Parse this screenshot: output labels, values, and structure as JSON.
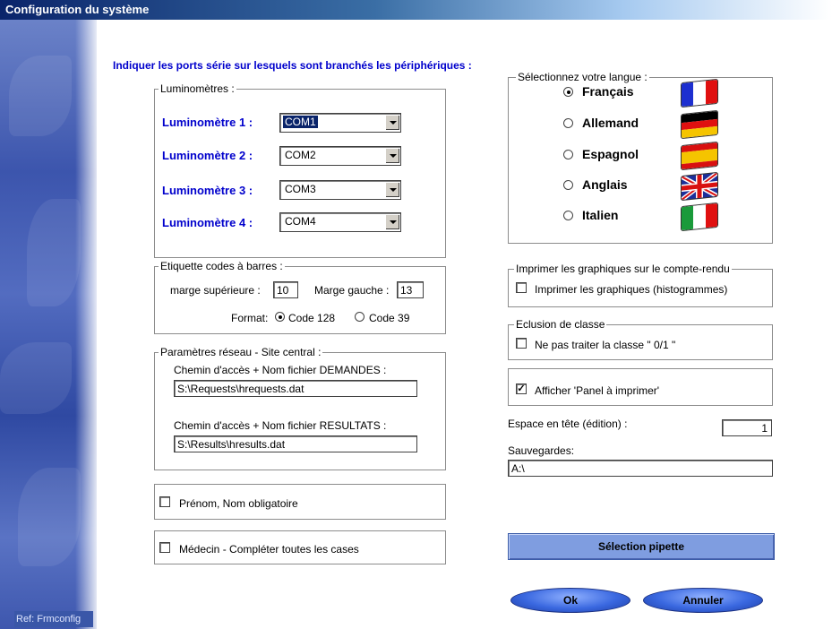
{
  "window": {
    "title": "Configuration du système",
    "ref": "Ref: Frmconfig"
  },
  "heading": "Indiquer les ports série sur lesquels sont branchés les périphériques :",
  "luminometres": {
    "legend": "Luminomètres :",
    "rows": [
      {
        "label": "Luminomètre 1 :",
        "value": "COM1"
      },
      {
        "label": "Luminomètre 2 :",
        "value": "COM2"
      },
      {
        "label": "Luminomètre 3 :",
        "value": "COM3"
      },
      {
        "label": "Luminomètre 4 :",
        "value": "COM4"
      }
    ]
  },
  "barcode": {
    "legend": "Etiquette codes à barres :",
    "marge_sup_label": "marge supérieure :",
    "marge_sup_value": "10",
    "marge_gauche_label": "Marge gauche :",
    "marge_gauche_value": "13",
    "format_label": "Format:",
    "code128": "Code 128",
    "code39": "Code 39",
    "selected": "Code 128"
  },
  "network": {
    "legend": "Paramètres réseau - Site central :",
    "demandes_label": "Chemin d'accès + Nom fichier DEMANDES :",
    "demandes_value": "S:\\Requests\\hrequests.dat",
    "resultats_label": "Chemin d'accès + Nom fichier RESULTATS :",
    "resultats_value": "S:\\Results\\hresults.dat"
  },
  "options": {
    "prenom_nom": {
      "label": "Prénom, Nom obligatoire",
      "checked": false
    },
    "medecin": {
      "label": "Médecin - Compléter toutes les cases",
      "checked": false
    }
  },
  "language": {
    "legend": "Sélectionnez votre langue :",
    "items": [
      {
        "label": "Français",
        "selected": true,
        "flag": "france-flag"
      },
      {
        "label": "Allemand",
        "selected": false,
        "flag": "germany-flag"
      },
      {
        "label": "Espagnol",
        "selected": false,
        "flag": "spain-flag"
      },
      {
        "label": "Anglais",
        "selected": false,
        "flag": "uk-flag"
      },
      {
        "label": "Italien",
        "selected": false,
        "flag": "italy-flag"
      }
    ]
  },
  "print_graphs": {
    "legend": "Imprimer les graphiques sur le compte-rendu",
    "label": "Imprimer les graphiques  (histogrammes)",
    "checked": false
  },
  "exclusion": {
    "legend": "Eclusion de classe",
    "label": "Ne pas traiter la classe \" 0/1 \"",
    "checked": false
  },
  "panel": {
    "label": "Afficher 'Panel à imprimer'",
    "checked": true
  },
  "espace": {
    "label": "Espace en tête (édition) :",
    "value": "1"
  },
  "sauvegardes": {
    "label": "Sauvegardes:",
    "value": "A:\\"
  },
  "buttons": {
    "pipette": "Sélection pipette",
    "ok": "Ok",
    "annuler": "Annuler"
  },
  "colors": {
    "title_bar": "#0a246a",
    "accent_blue": "#0000cc",
    "sidebar": "#3c55ad",
    "button": "#7f9de0"
  }
}
